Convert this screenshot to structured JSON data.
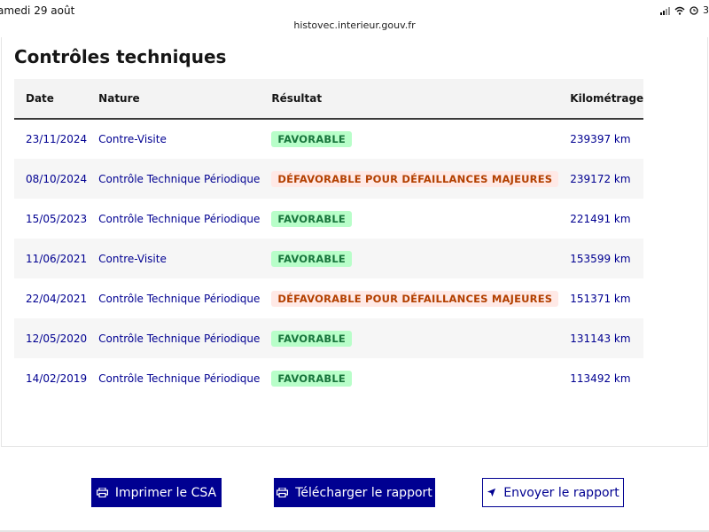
{
  "status": {
    "date": "amedi 29 août",
    "battery": "3"
  },
  "browser": {
    "url": "histovec.interieur.gouv.fr"
  },
  "section": {
    "title": "Contrôles techniques"
  },
  "table": {
    "headers": [
      "Date",
      "Nature",
      "Résultat",
      "Kilométrage"
    ],
    "rows": [
      {
        "date": "23/11/2024",
        "nature": "Contre-Visite",
        "result": "FAVORABLE",
        "km": "239397 km"
      },
      {
        "date": "08/10/2024",
        "nature": "Contrôle Technique Périodique",
        "result": "DÉFAVORABLE POUR DÉFAILLANCES MAJEURES",
        "km": "239172 km"
      },
      {
        "date": "15/05/2023",
        "nature": "Contrôle Technique Périodique",
        "result": "FAVORABLE",
        "km": "221491 km"
      },
      {
        "date": "11/06/2021",
        "nature": "Contre-Visite",
        "result": "FAVORABLE",
        "km": "153599 km"
      },
      {
        "date": "22/04/2021",
        "nature": "Contrôle Technique Périodique",
        "result": "DÉFAVORABLE POUR DÉFAILLANCES MAJEURES",
        "km": "151371 km"
      },
      {
        "date": "12/05/2020",
        "nature": "Contrôle Technique Périodique",
        "result": "FAVORABLE",
        "km": "131143 km"
      },
      {
        "date": "14/02/2019",
        "nature": "Contrôle Technique Périodique",
        "result": "FAVORABLE",
        "km": "113492 km"
      }
    ]
  },
  "actions": {
    "print_label": "Imprimer le CSA",
    "print_icon": "printer-icon",
    "download_label": "Télécharger le rapport",
    "download_icon": "printer-icon",
    "send_label": "Envoyer le rapport",
    "send_icon": "send-icon"
  },
  "colors": {
    "primary": "#000091",
    "success_bg": "#b8fec9",
    "success_text": "#18753c",
    "error_bg": "#ffe9e6",
    "error_text": "#b34000"
  }
}
